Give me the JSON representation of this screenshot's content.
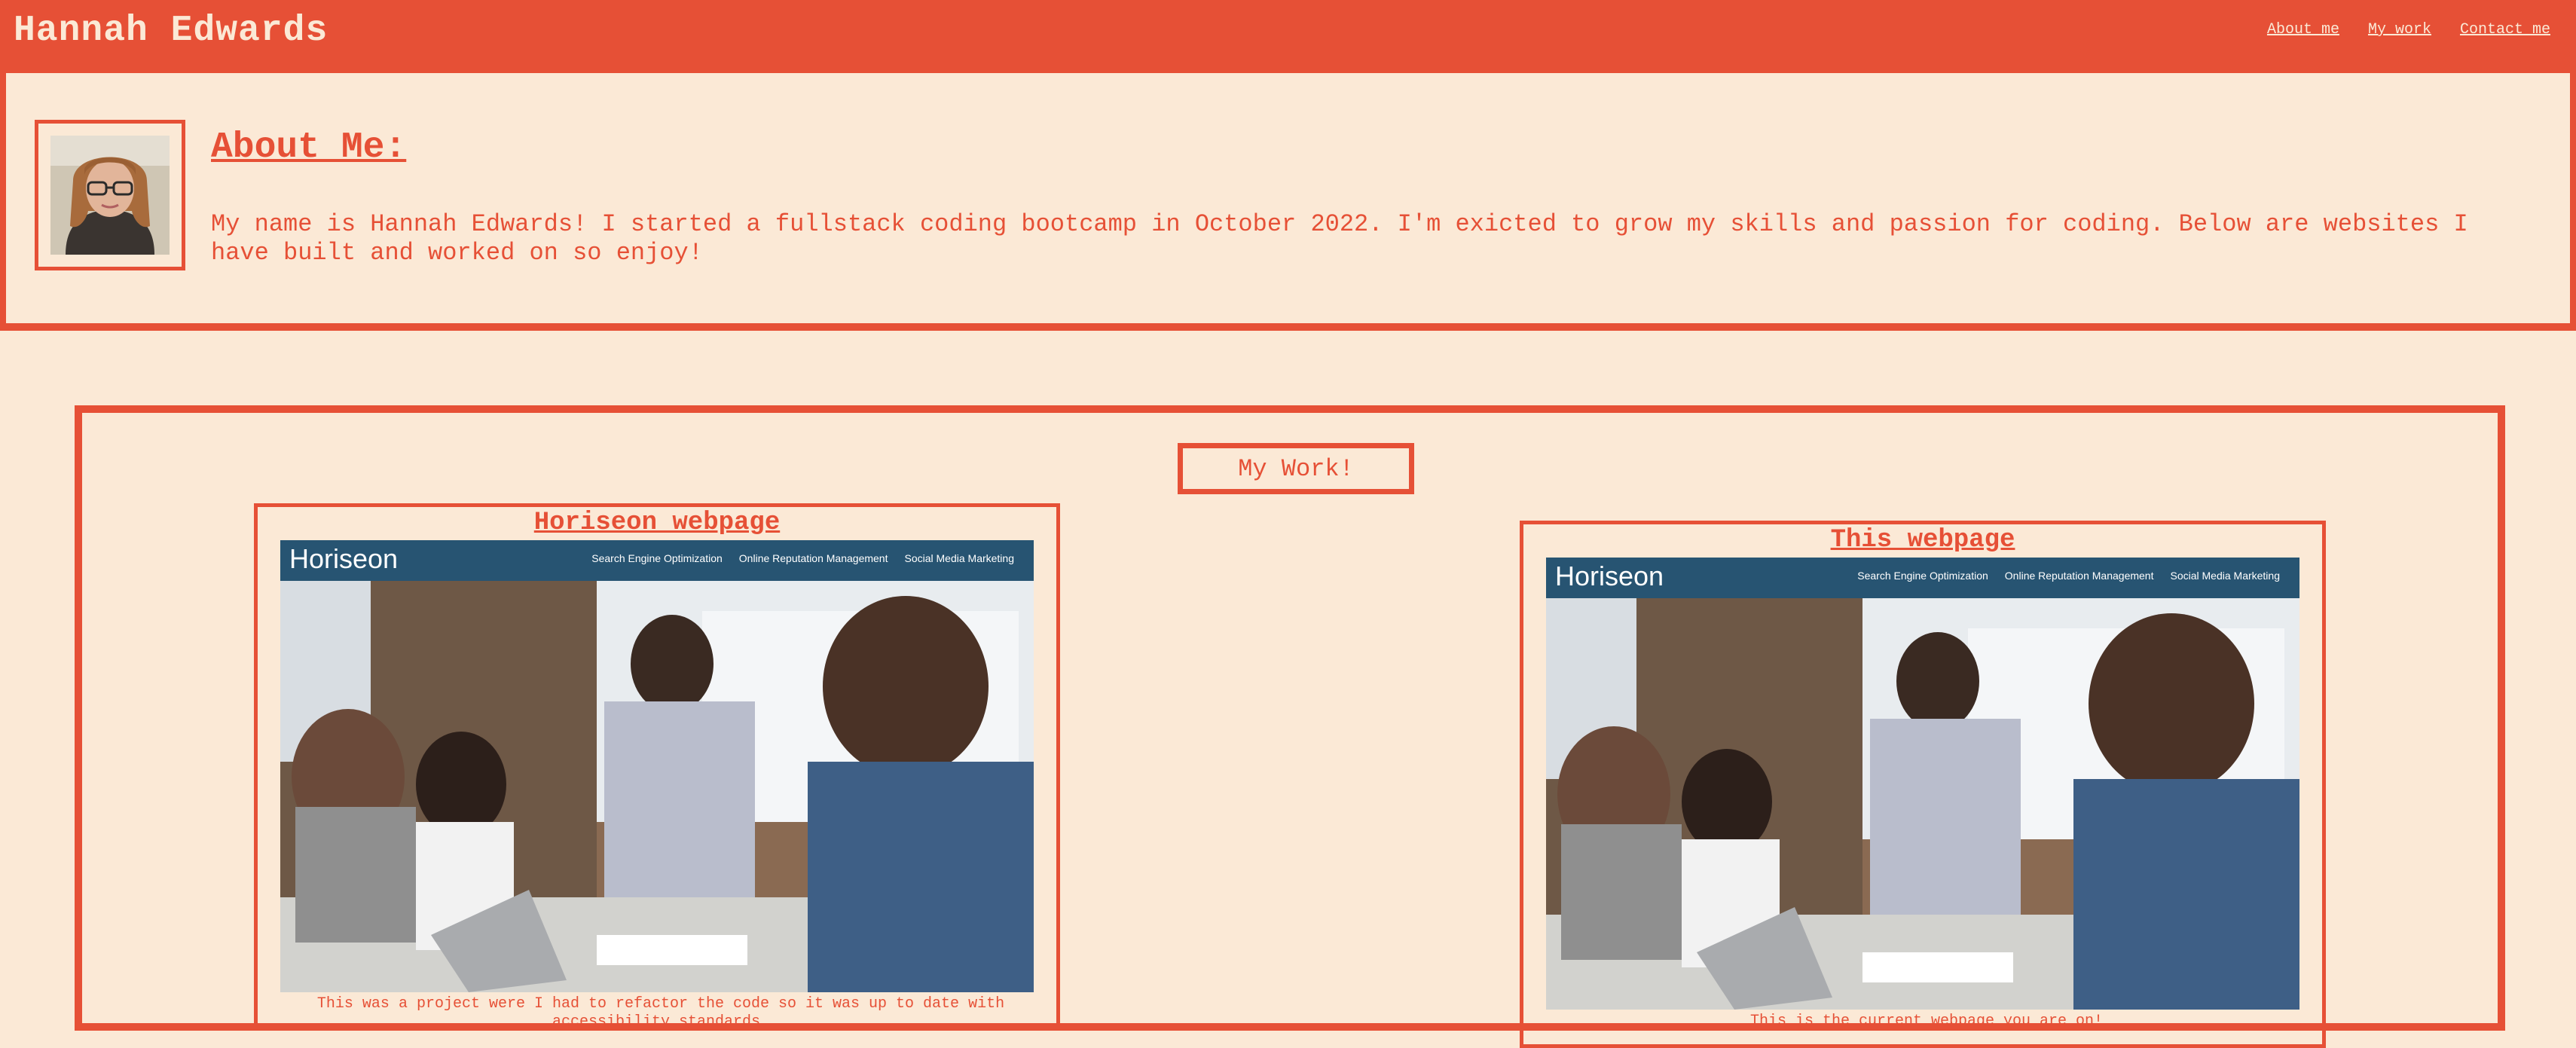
{
  "header": {
    "site_title": "Hannah Edwards",
    "nav": [
      "About me",
      "My work",
      "Contact me"
    ]
  },
  "about": {
    "heading": "About Me:",
    "text": "My name is Hannah Edwards! I started a fullstack coding bootcamp in October 2022. I'm exicted to grow my skills and passion for coding. Below are websites I have built and worked on so enjoy!"
  },
  "work": {
    "title": "My Work!",
    "projects": [
      {
        "title": "Horiseon webpage",
        "caption": "This was a project were I had to refactor the code so it was up to date with accessibility standards.",
        "screenshot": {
          "logo": "Horiseon",
          "nav": [
            "Search Engine Optimization",
            "Online Reputation Management",
            "Social Media Marketing"
          ]
        }
      },
      {
        "title": "This webpage",
        "caption": "This is the current webpage you are on!",
        "screenshot": {
          "logo": "Horiseon",
          "nav": [
            "Search Engine Optimization",
            "Online Reputation Management",
            "Social Media Marketing"
          ]
        }
      }
    ]
  },
  "colors": {
    "accent": "#e65036",
    "background": "#fbe9d6",
    "horiseon_bar": "#275472"
  }
}
